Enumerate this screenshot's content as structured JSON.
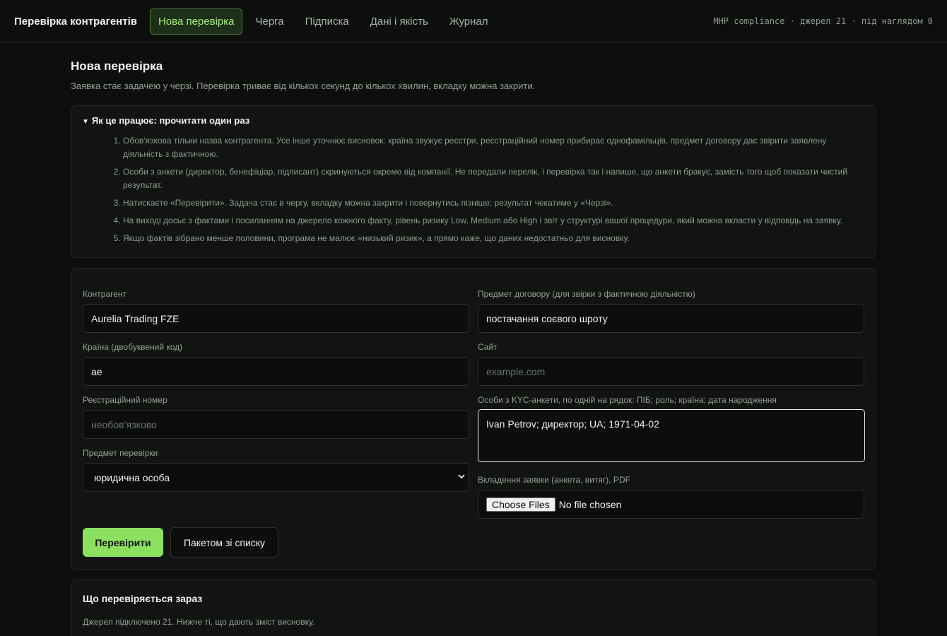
{
  "nav": {
    "brand": "Перевірка контрагентів",
    "tabs": [
      {
        "label": "Нова перевірка",
        "active": true
      },
      {
        "label": "Черга",
        "active": false
      },
      {
        "label": "Підписка",
        "active": false
      },
      {
        "label": "Дані і якість",
        "active": false
      },
      {
        "label": "Журнал",
        "active": false
      }
    ],
    "status": "MHP compliance · джерел 21 · під наглядом 0"
  },
  "page": {
    "title": "Нова перевірка",
    "subtitle": "Заявка стає задачею у черзі. Перевірка триває від кількох секунд до кількох хвилин, вкладку можна закрити."
  },
  "howto": {
    "summary": "Як це працює: прочитати один раз",
    "steps": [
      "Обов'язкова тільки назва контрагента. Усе інше уточнює висновок: країна звужує реєстри, реєстраційний номер прибирає однофамільців, предмет договору дає звірити заявлену діяльність з фактичною.",
      "Особи з анкети (директор, бенефіціар, підписант) скринуються окремо від компанії. Не передали перелік, і перевірка так і напише, що анкети бракує, замість того щоб показати чистий результат.",
      "Натискаєте «Перевірити». Задача стає в чергу, вкладку можна закрити і повернутись пізніше: результат чекатиме у «Черзі».",
      "На виході досьє з фактами і посиланням на джерело кожного факту, рівень ризику Low, Medium або High і звіт у структурі вашої процедури, який можна вкласти у відповідь на заявку.",
      "Якщо фактів зібрано менше половини, програма не малює «низький ризик», а прямо каже, що даних недостатньо для висновку."
    ]
  },
  "form": {
    "counterparty": {
      "label": "Контрагент",
      "value": "Aurelia Trading FZE"
    },
    "subject": {
      "label": "Предмет договору (для звірки з фактичною діяльністю)",
      "value": "постачання соєвого шроту"
    },
    "country": {
      "label": "Країна (двобуквений код)",
      "value": "ae"
    },
    "site": {
      "label": "Сайт",
      "placeholder": "example.com"
    },
    "regnum": {
      "label": "Реєстраційний номер",
      "placeholder": "необов’язково"
    },
    "persons": {
      "label": "Особи з KYC-анкети, по одній на рядок: ПІБ; роль; країна; дата народження",
      "value": "Ivan Petrov; директор; UA; 1971-04-02"
    },
    "check_subject": {
      "label": "Предмет перевірки",
      "value": "юридична особа"
    },
    "attachment": {
      "label": "Вкладення заявки (анкета, витяг), PDF",
      "button": "Choose Files",
      "status": "No file chosen"
    },
    "submit": "Перевірити",
    "batch": "Пакетом зі списку"
  },
  "checking": {
    "title": "Що перевіряється зараз",
    "subtitle": "Джерел підключено 21. Нижче ті, що дають зміст висновку."
  }
}
